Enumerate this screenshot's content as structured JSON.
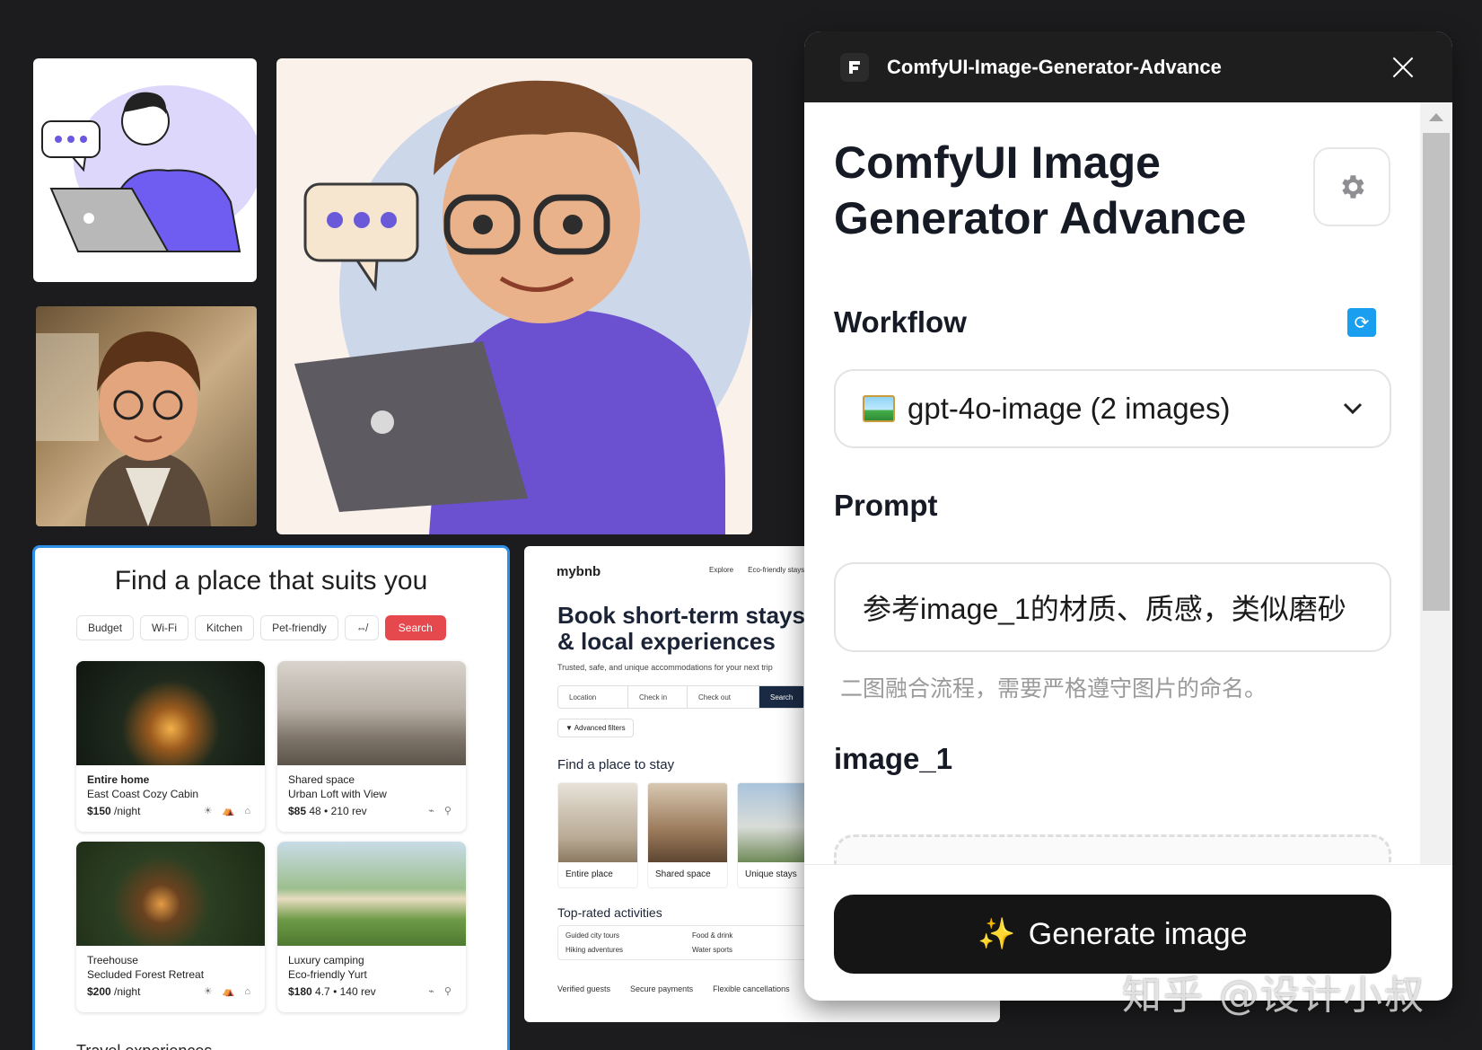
{
  "panel": {
    "app_title": "ComfyUI-Image-Generator-Advance",
    "heading": "ComfyUI Image Generator Advance",
    "workflow_label": "Workflow",
    "workflow_value": "gpt-4o-image (2 images)",
    "prompt_label": "Prompt",
    "prompt_value": "参考image_1的材质、质感，类似磨砂",
    "prompt_hint": "二图融合流程，需要严格遵守图片的命名。",
    "image1_label": "image_1",
    "generate_label": "Generate image",
    "generate_emoji": "✨"
  },
  "find_card": {
    "title": "Find a place that suits you",
    "chips": [
      "Budget",
      "Wi-Fi",
      "Kitchen",
      "Pet-friendly",
      "⇎"
    ],
    "search_label": "Search",
    "listings": [
      {
        "type": "Entire home",
        "name": "East Coast Cozy Cabin",
        "price": "$150",
        "unit": "/night",
        "meta": "",
        "amenities": "☀ ⛺ ⌂"
      },
      {
        "type": "Shared space",
        "name": "Urban Loft with View",
        "price": "$85",
        "unit": "",
        "meta": "48 • 210 rev",
        "amenities": "⌁ ⚲"
      },
      {
        "type": "Treehouse",
        "name": "Secluded Forest Retreat",
        "price": "$200",
        "unit": "/night",
        "meta": "",
        "amenities": "☀ ⛺ ⌂"
      },
      {
        "type": "Luxury camping",
        "name": "Eco-friendly Yurt",
        "price": "$180",
        "unit": "",
        "meta": "4.7 • 140 rev",
        "amenities": "⌁ ⚲"
      }
    ],
    "footer_heading": "Travel experiences"
  },
  "bnb": {
    "logo": "mybnb",
    "nav": [
      "Explore",
      "Eco-friendly stays"
    ],
    "headline": "Book short-term stays & local experiences",
    "subtitle": "Trusted, safe, and unique accommodations for your next trip",
    "search_fields": [
      "Location",
      "Check in",
      "Check out"
    ],
    "search_button": "Search",
    "filters": "▼ Advanced filters",
    "section_stay": "Find a place to stay",
    "categories": [
      "Entire place",
      "Shared space",
      "Unique stays"
    ],
    "section_activities": "Top-rated activities",
    "activities": [
      "Guided city tours",
      "Food & drink",
      "Hiking adventures",
      "Water sports"
    ],
    "trust": [
      "Verified guests",
      "Secure payments",
      "Flexible cancellations"
    ]
  },
  "watermark": "知乎 @设计小叔",
  "colors": {
    "background": "#1c1c1e",
    "accent_blue": "#2f8fe6",
    "accent_red": "#e5484d",
    "panel_header": "#1e1e1e",
    "button_dark": "#151515",
    "refresh_blue": "#1a9ff0"
  },
  "icons": {
    "app_logo": "comfyui-logo-icon",
    "close": "close-icon",
    "settings": "gear-icon",
    "refresh": "refresh-icon",
    "dropdown": "chevron-down-icon",
    "workflow_emoji": "framed-picture-icon",
    "generate": "sparkles-icon"
  }
}
